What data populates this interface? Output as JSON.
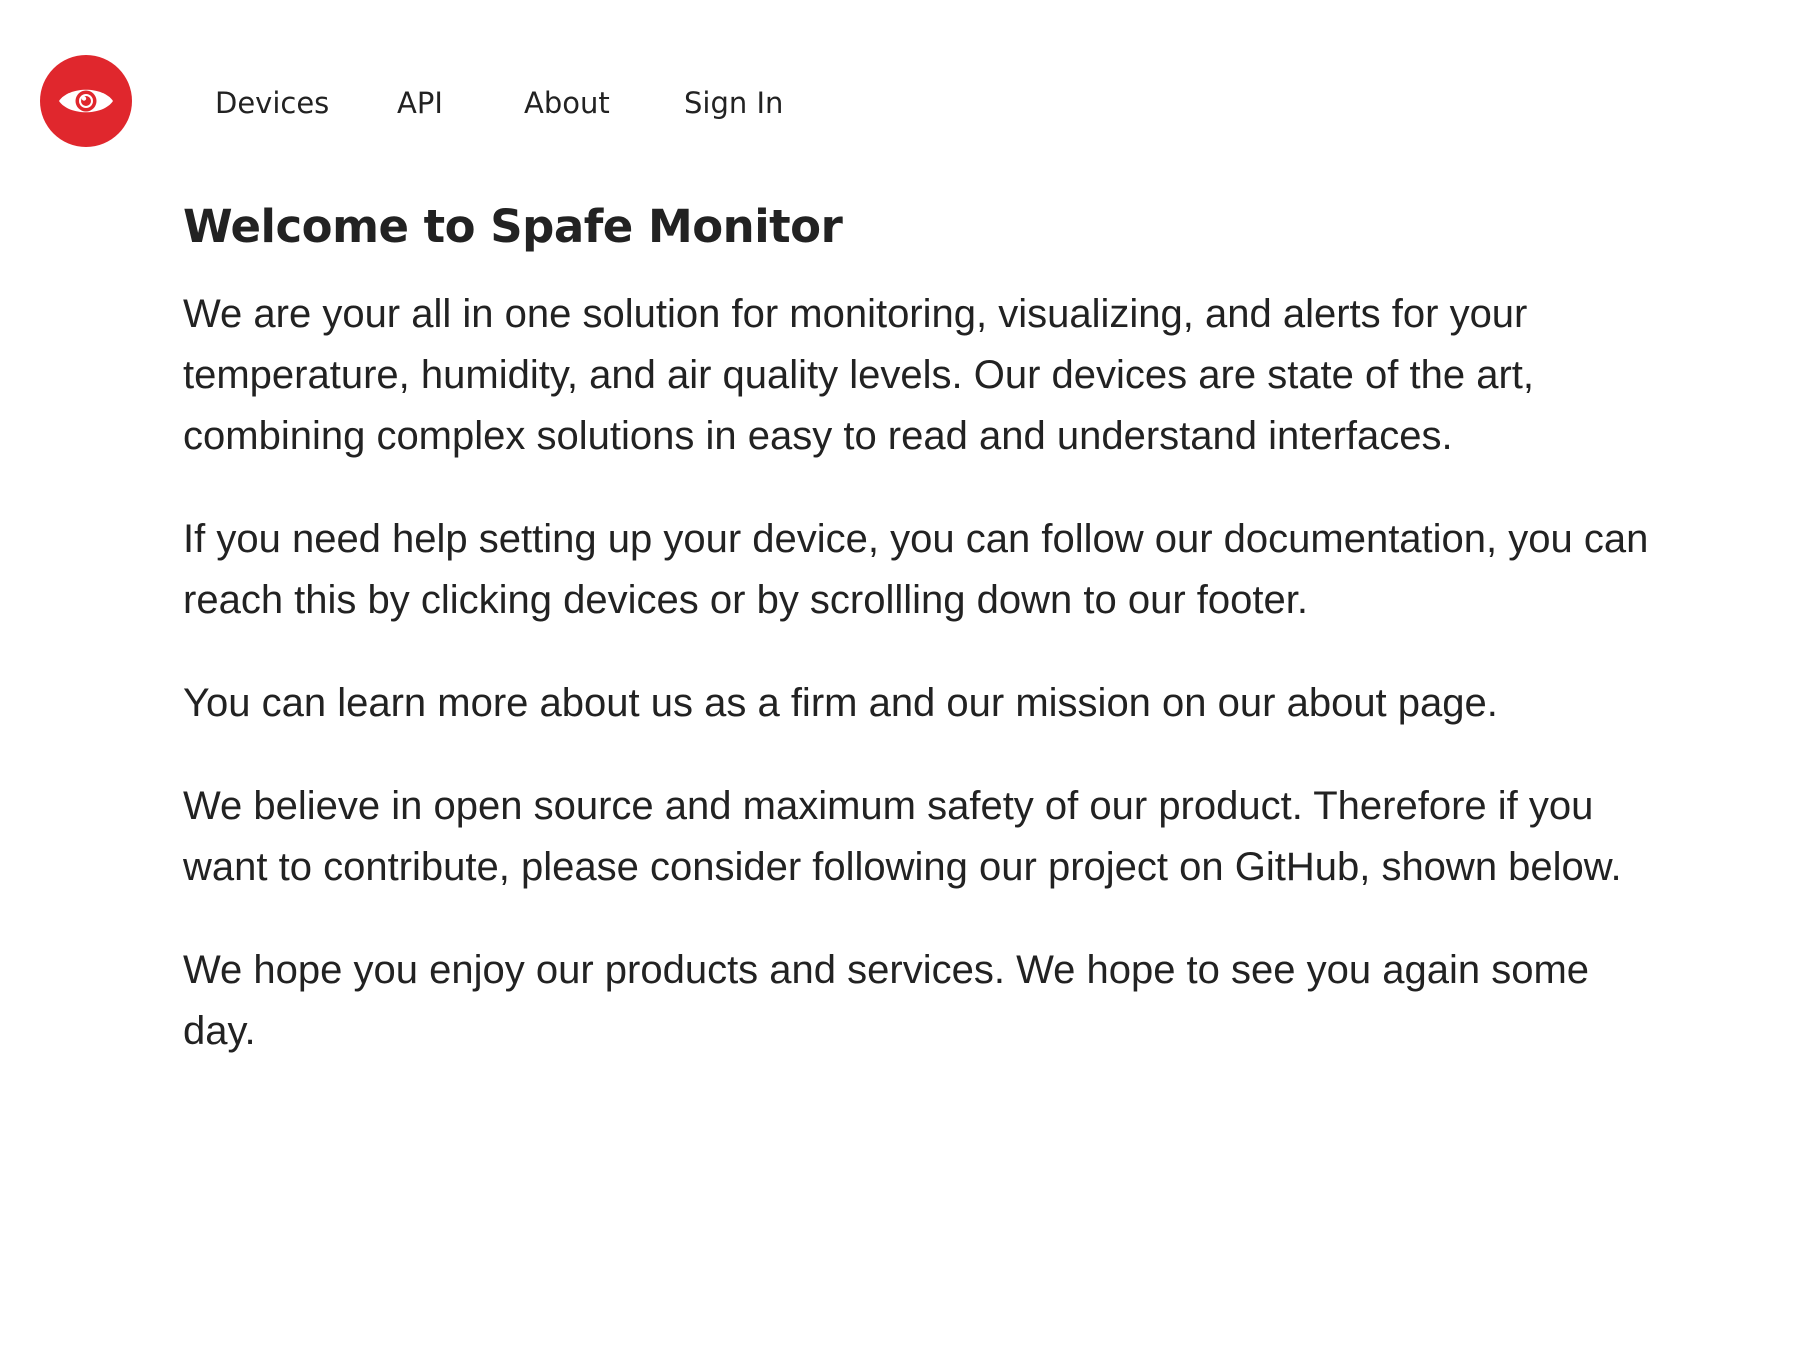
{
  "header": {
    "logo_icon": "eye-icon",
    "logo_color": "#e0272d",
    "nav": {
      "devices": "Devices",
      "api": "API",
      "about": "About",
      "sign_in": "Sign In"
    }
  },
  "main": {
    "title": "Welcome to Spafe Monitor",
    "paragraphs": [
      "We are your all in one solution for monitoring, visualizing, and alerts for your temperature, humidity, and air quality levels. Our devices are state of the art, combining complex solutions in easy to read and understand interfaces.",
      "If you need help setting up your device, you can follow our documentation, you can reach this by clicking devices or by scrollling down to our footer.",
      "You can learn more about us as a firm and our mission on our about page.",
      "We believe in open source and maximum safety of our product. Therefore if you want to contribute, please consider following our project on GitHub, shown below.",
      "We hope you enjoy our products and services. We hope to see you again some day."
    ]
  }
}
